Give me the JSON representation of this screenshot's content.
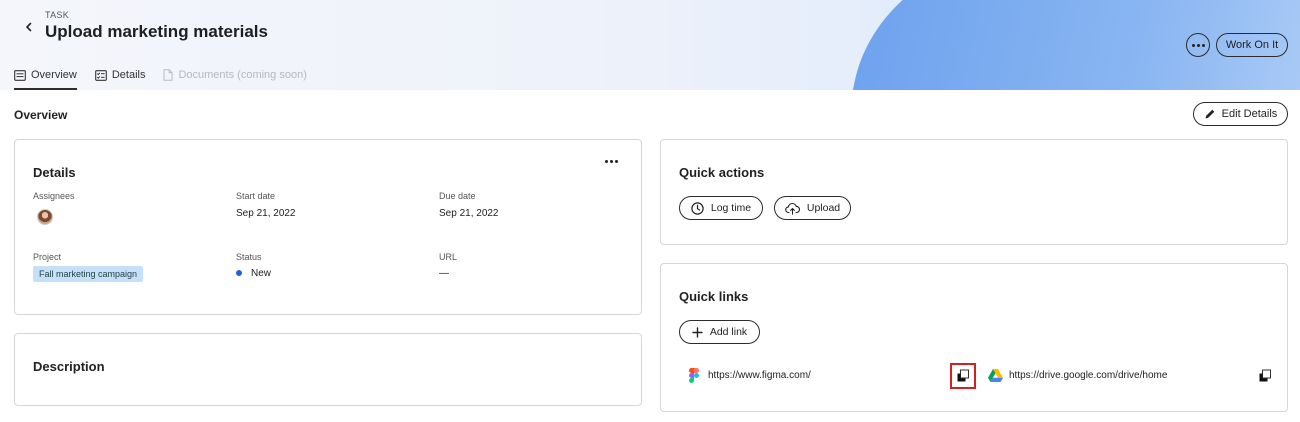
{
  "header": {
    "kicker": "TASK",
    "title": "Upload marketing materials",
    "tabs": [
      {
        "label": "Overview",
        "icon": "list-icon",
        "state": "active"
      },
      {
        "label": "Details",
        "icon": "checklist-icon",
        "state": "normal"
      },
      {
        "label": "Documents (coming soon)",
        "icon": "document-icon",
        "state": "disabled"
      }
    ],
    "work_on_it_label": "Work On It"
  },
  "overview": {
    "section_title": "Overview",
    "edit_label": "Edit Details"
  },
  "details_card": {
    "title": "Details",
    "assignees_label": "Assignees",
    "start_label": "Start date",
    "start_value": "Sep 21, 2022",
    "due_label": "Due date",
    "due_value": "Sep 21, 2022",
    "project_label": "Project",
    "project_value": "Fall marketing campaign",
    "status_label": "Status",
    "status_value": "New",
    "status_color": "#1f62e0",
    "url_label": "URL",
    "url_value": "—"
  },
  "description_card": {
    "title": "Description"
  },
  "quick_actions": {
    "title": "Quick actions",
    "log_time_label": "Log time",
    "upload_label": "Upload"
  },
  "quick_links": {
    "title": "Quick links",
    "add_link_label": "Add link",
    "links": [
      {
        "url": "https://www.figma.com/",
        "icon": "figma-icon"
      },
      {
        "url": "https://drive.google.com/drive/home",
        "icon": "google-drive-icon"
      }
    ]
  },
  "colors": {
    "accent_blue": "#1f62e0",
    "highlight_red": "#d32020",
    "tag_bg": "#c7e0f9"
  }
}
